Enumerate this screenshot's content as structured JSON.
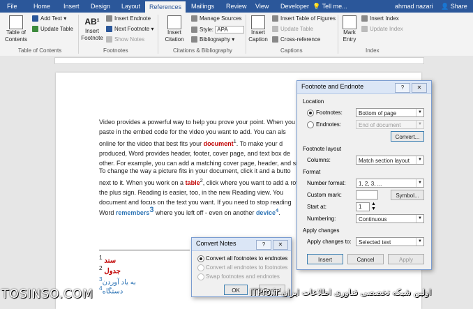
{
  "tabs": [
    "File",
    "Home",
    "Insert",
    "Design",
    "Layout",
    "References",
    "Mailings",
    "Review",
    "View",
    "Developer"
  ],
  "active_tab": "References",
  "tell_me": "Tell me...",
  "user": "ahmad nazari",
  "share": "Share",
  "ribbon": {
    "toc": {
      "label": "Table of Contents",
      "add_text": "Add Text",
      "update_table": "Update Table",
      "group": "Table of Contents"
    },
    "footnotes": {
      "insert_footnote": "Insert Footnote",
      "insert_endnote": "Insert Endnote",
      "next_footnote": "Next Footnote",
      "show_notes": "Show Notes",
      "group": "Footnotes"
    },
    "citations": {
      "insert_citation": "Insert Citation",
      "manage_sources": "Manage Sources",
      "style_label": "Style:",
      "style_value": "APA",
      "bibliography": "Bibliography",
      "group": "Citations & Bibliography"
    },
    "captions": {
      "insert_caption": "Insert Caption",
      "insert_tof": "Insert Table of Figures",
      "update_table": "Update Table",
      "cross_reference": "Cross-reference",
      "group": "Captions"
    },
    "index": {
      "mark_entry": "Mark Entry",
      "insert_index": "Insert Index",
      "update_index": "Update Index",
      "group": "Index"
    }
  },
  "document": {
    "p1": [
      "Video provides a powerful way to help you prove your point. When you",
      "paste in the embed code for the video you want to add. You can als",
      "online for the video that best fits your ",
      "produced, Word provides header, footer, cover page, and text box de",
      "other. For example, you can add a matching cover page, header, and sid"
    ],
    "p1_word": "document",
    "p1_sup": "1",
    "p1_tail": ". To make your d",
    "p2": [
      "To change the way a picture fits in your document, click it and a butto",
      "next to it. When you work on a ",
      "the plus sign. Reading is easier, too, in the new Reading view. You",
      "document and focus on the text you want. If you need to stop reading"
    ],
    "p2_word": "table",
    "p2_sup": "2",
    "p2_tail": ", click where you want to add a rov",
    "p3_start": "Word ",
    "p3_word1": "remembers",
    "p3_sup1": "3",
    "p3_mid": " where you left off - even on another ",
    "p3_word2": "device",
    "p3_sup2": "4",
    "p3_end": ".",
    "footnotes": [
      {
        "num": "1",
        "text": "سند"
      },
      {
        "num": "2",
        "text": "جدول"
      },
      {
        "num": "3",
        "text": "به یاد آوردن"
      },
      {
        "num": "4",
        "text": "دستگاه"
      }
    ]
  },
  "footnote_dialog": {
    "title": "Footnote and Endnote",
    "help": "?",
    "close": "✕",
    "location": "Location",
    "footnotes_label": "Footnotes:",
    "footnotes_value": "Bottom of page",
    "endnotes_label": "Endnotes:",
    "endnotes_value": "End of document",
    "convert": "Convert...",
    "layout": "Footnote layout",
    "columns_label": "Columns:",
    "columns_value": "Match section layout",
    "format": "Format",
    "number_format_label": "Number format:",
    "number_format_value": "1, 2, 3, ...",
    "custom_mark_label": "Custom mark:",
    "symbol": "Symbol...",
    "start_at_label": "Start at:",
    "start_at_value": "1",
    "numbering_label": "Numbering:",
    "numbering_value": "Continuous",
    "apply": "Apply changes",
    "apply_to_label": "Apply changes to:",
    "apply_to_value": "Selected text",
    "insert": "Insert",
    "cancel": "Cancel",
    "apply_btn": "Apply"
  },
  "convert_dialog": {
    "title": "Convert Notes",
    "help": "?",
    "close": "✕",
    "opt1": "Convert all footnotes to endnotes",
    "opt2": "Convert all endnotes to footnotes",
    "opt3": "Swap footnotes and endnotes",
    "ok": "OK",
    "cancel": "Cancel"
  },
  "watermark": {
    "left": "TOSINSO.COM",
    "right": "ITPro.ir اولین شبکه تخصصی فناوری اطلاعات ایران"
  },
  "colors": {
    "word_blue": "#2b579a",
    "ribbon_bg": "#f3f3f3",
    "red_text": "#c00000",
    "blue_text": "#2e75b6"
  }
}
